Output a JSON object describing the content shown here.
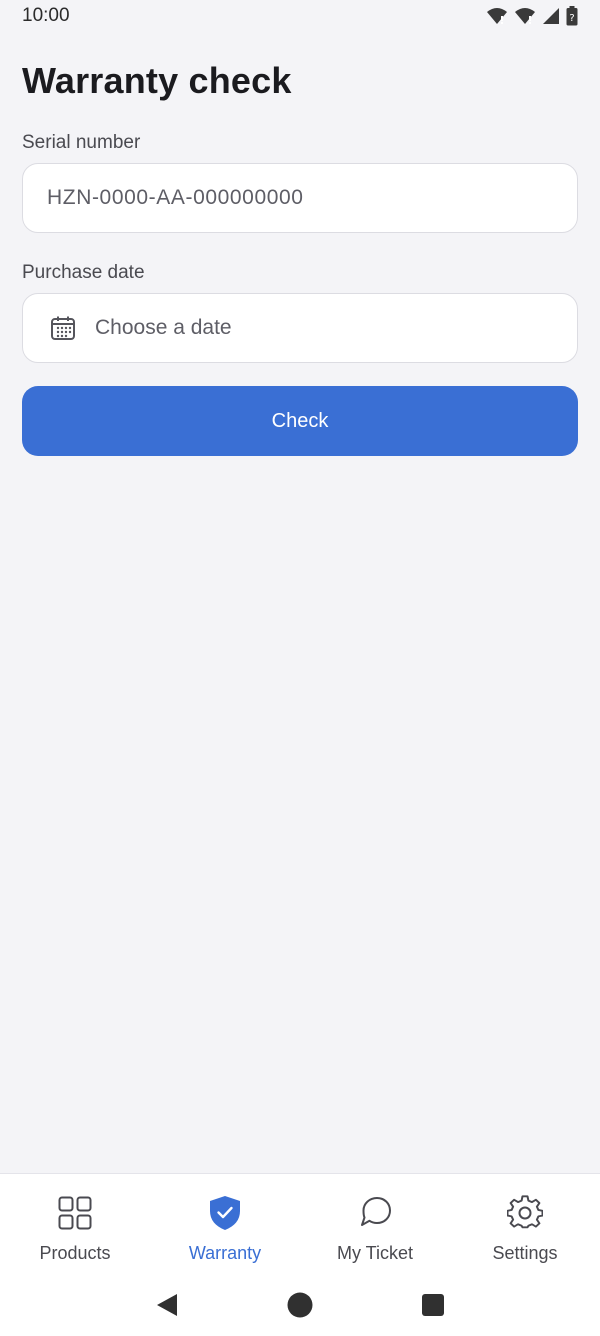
{
  "status_bar": {
    "time": "10:00",
    "icons": [
      "wifi-icon",
      "signal-icon",
      "cell-signal-icon",
      "battery-icon"
    ]
  },
  "page": {
    "title": "Warranty check"
  },
  "form": {
    "serial_label": "Serial number",
    "serial_placeholder": "HZN-0000-AA-000000000",
    "serial_value": "",
    "date_label": "Purchase date",
    "date_placeholder": "Choose a date",
    "check_button": "Check"
  },
  "bottom_nav": {
    "items": [
      {
        "label": "Products",
        "icon": "grid-icon",
        "active": false
      },
      {
        "label": "Warranty",
        "icon": "shield-check-icon",
        "active": true
      },
      {
        "label": "My Ticket",
        "icon": "chat-bubble-icon",
        "active": false
      },
      {
        "label": "Settings",
        "icon": "gear-icon",
        "active": false
      }
    ]
  },
  "colors": {
    "accent": "#3a6fd4",
    "background": "#f4f4f7",
    "surface": "#ffffff",
    "text": "#1b1b1f",
    "muted_text": "#4a4a50"
  }
}
